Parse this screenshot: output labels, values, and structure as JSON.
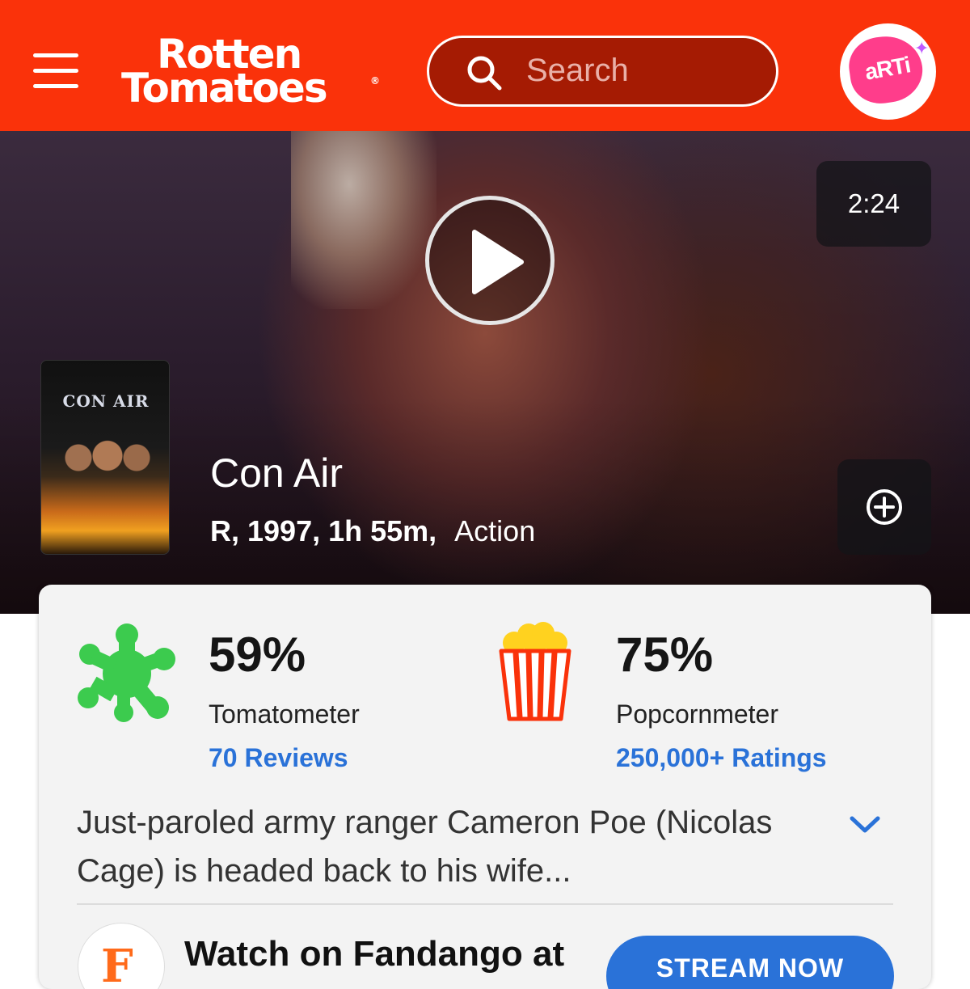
{
  "header": {
    "menu_icon": "hamburger-menu-icon",
    "logo_line1": "Rotten",
    "logo_line2": "Tomatoes",
    "logo_mark": "®",
    "search_placeholder": "Search",
    "search_icon": "search-icon",
    "avatar_text": "aRTi",
    "brand_color": "#fa320a"
  },
  "hero": {
    "video_duration": "2:24",
    "play_icon": "play-icon",
    "poster_title": "CON AIR",
    "movie_title": "Con Air",
    "movie_info": "R, 1997, 1h 55m,",
    "genre": "Action",
    "add_icon": "plus-circle-icon"
  },
  "scores": {
    "tomatometer": {
      "value": "59%",
      "label": "Tomatometer",
      "link": "70 Reviews",
      "icon": "green-splat-icon",
      "color": "#3ccb4e"
    },
    "popcornmeter": {
      "value": "75%",
      "label": "Popcornmeter",
      "link": "250,000+ Ratings",
      "icon": "popcorn-bucket-icon",
      "color": "#fa320a"
    },
    "link_color": "#2a72d8"
  },
  "synopsis": {
    "text": "Just-paroled army ranger Cameron Poe (Nicolas Cage) is headed back to his wife...",
    "expand_icon": "chevron-down-icon"
  },
  "watch": {
    "provider_logo": "F",
    "text": "Watch on Fandango at",
    "button_label": "STREAM NOW"
  }
}
